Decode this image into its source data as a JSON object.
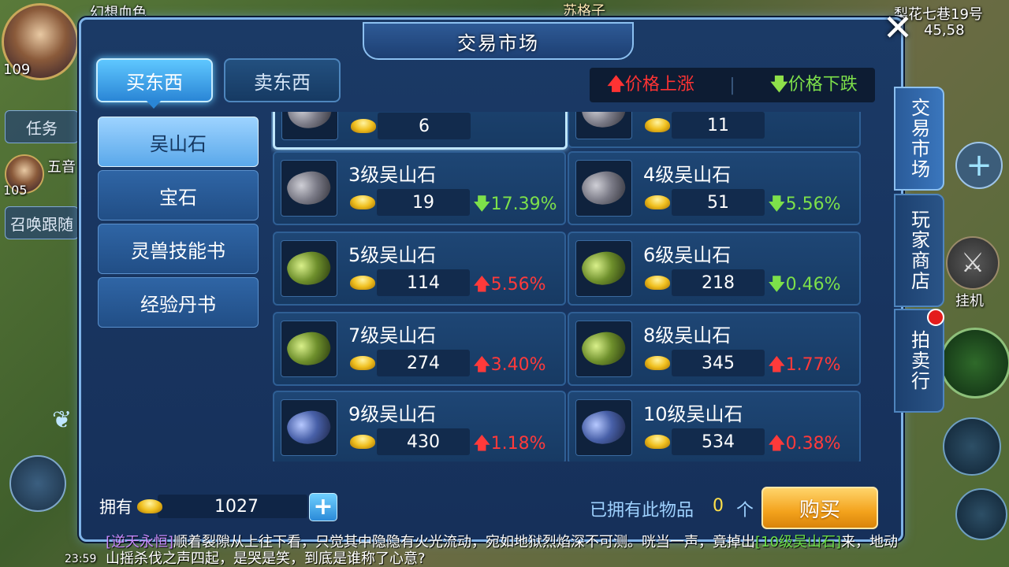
{
  "background_hud": {
    "top_left_name": "幻想血色",
    "top_left_level": "109",
    "top_center_name": "苏格子",
    "location_name": "梨花七巷19号",
    "location_coords": "45,58",
    "task_button": "任务",
    "teammate_name": "五音",
    "teammate_level": "105",
    "summon_follow_button": "召唤跟随",
    "auto_battle_label": "挂机",
    "corner_time": "23:59"
  },
  "panel": {
    "title": "交易市场",
    "close_symbol": "✕"
  },
  "tabs": {
    "buy": "买东西",
    "sell": "卖东西"
  },
  "legend": {
    "up_arrow": "🡅",
    "up_label": "价格上涨",
    "down_arrow": "🡇",
    "down_label": "价格下跌"
  },
  "categories": [
    {
      "label": "吴山石",
      "active": true
    },
    {
      "label": "宝石",
      "active": false
    },
    {
      "label": "灵兽技能书",
      "active": false
    },
    {
      "label": "经验丹书",
      "active": false
    }
  ],
  "items": [
    {
      "name": "",
      "price": "6",
      "change": "",
      "dir": "",
      "rock": "gray",
      "selected": true
    },
    {
      "name": "",
      "price": "11",
      "change": "",
      "dir": "",
      "rock": "gray",
      "selected": false
    },
    {
      "name": "3级吴山石",
      "price": "19",
      "change": "17.39%",
      "dir": "down",
      "rock": "gray",
      "selected": false
    },
    {
      "name": "4级吴山石",
      "price": "51",
      "change": "5.56%",
      "dir": "down",
      "rock": "gray",
      "selected": false
    },
    {
      "name": "5级吴山石",
      "price": "114",
      "change": "5.56%",
      "dir": "up",
      "rock": "green",
      "selected": false
    },
    {
      "name": "6级吴山石",
      "price": "218",
      "change": "0.46%",
      "dir": "down",
      "rock": "green",
      "selected": false
    },
    {
      "name": "7级吴山石",
      "price": "274",
      "change": "3.40%",
      "dir": "up",
      "rock": "green",
      "selected": false
    },
    {
      "name": "8级吴山石",
      "price": "345",
      "change": "1.77%",
      "dir": "up",
      "rock": "green",
      "selected": false
    },
    {
      "name": "9级吴山石",
      "price": "430",
      "change": "1.18%",
      "dir": "up",
      "rock": "blue",
      "selected": false
    },
    {
      "name": "10级吴山石",
      "price": "534",
      "change": "0.38%",
      "dir": "up",
      "rock": "blue",
      "selected": false
    }
  ],
  "footer": {
    "own_label": "拥有",
    "own_value": "1027",
    "add_symbol": "+",
    "owned_label": "已拥有此物品",
    "owned_count": "0",
    "owned_unit": "个",
    "buy_button": "购买"
  },
  "side_tabs": {
    "market": "交易市场",
    "player_shop": "玩家商店",
    "auction": "拍卖行"
  },
  "chat": {
    "speaker": "[逆天永恒]",
    "text_before": "顺着裂隙从上往下看，只觉其中隐隐有火光流动，宛如地狱烈焰深不可测。咣当一声，竟掉出",
    "item_link": "[10级吴山石]",
    "text_after": "来，地动山摇杀伐之声四起，是哭是笑，到底是谁称了心意?"
  },
  "colors": {
    "panel_bg": "#16305a",
    "accent_blue": "#5fc7ff",
    "price_up": "#ff3a3a",
    "price_down": "#7de04a",
    "buy_button": "#f3a21c"
  }
}
